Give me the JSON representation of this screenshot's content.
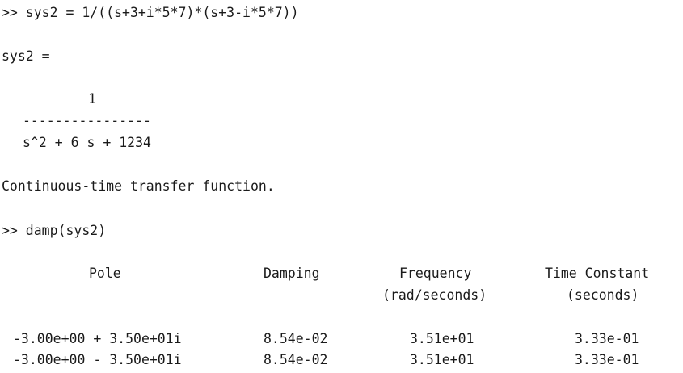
{
  "console": {
    "command1": ">> sys2 = 1/((s+3+i*5*7)*(s+3-i*5*7))",
    "assign_label": "sys2 =",
    "numerator": "1",
    "fraction_bar": "----------------",
    "denominator": "s^2 + 6 s + 1234",
    "description": "Continuous-time transfer function.",
    "command2": ">> damp(sys2)",
    "damp_table": {
      "headers": {
        "pole": "Pole",
        "damping": "Damping",
        "frequency": "Frequency",
        "frequency_unit": "(rad/seconds)",
        "time_constant": "Time Constant",
        "time_constant_unit": "(seconds)"
      },
      "rows": [
        {
          "pole": "-3.00e+00 + 3.50e+01i",
          "damping": "8.54e-02",
          "frequency": "3.51e+01",
          "time_constant": "3.33e-01"
        },
        {
          "pole": "-3.00e+00 - 3.50e+01i",
          "damping": "8.54e-02",
          "frequency": "3.51e+01",
          "time_constant": "3.33e-01"
        }
      ]
    }
  }
}
